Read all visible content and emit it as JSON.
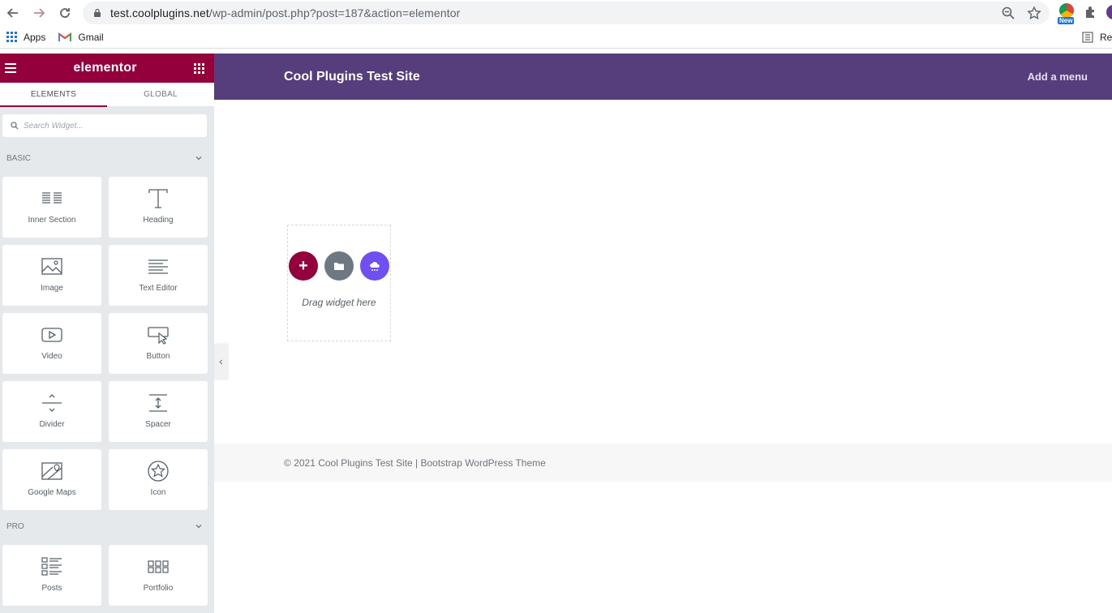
{
  "browser": {
    "url_host": "test.coolplugins.net",
    "url_path": "/wp-admin/post.php?post=187&action=elementor",
    "ext_badge": "New",
    "bookmarks": [
      {
        "label": "Apps"
      },
      {
        "label": "Gmail"
      }
    ],
    "reading_list_label": "Re"
  },
  "panel": {
    "brand": "elementor",
    "tabs": [
      {
        "label": "ELEMENTS"
      },
      {
        "label": "GLOBAL"
      }
    ],
    "search_placeholder": "Search Widget...",
    "categories": [
      {
        "label": "BASIC"
      },
      {
        "label": "PRO"
      }
    ],
    "basic_widgets": [
      {
        "label": "Inner Section",
        "icon": "inner-section-icon"
      },
      {
        "label": "Heading",
        "icon": "heading-icon"
      },
      {
        "label": "Image",
        "icon": "image-icon"
      },
      {
        "label": "Text Editor",
        "icon": "text-editor-icon"
      },
      {
        "label": "Video",
        "icon": "video-icon"
      },
      {
        "label": "Button",
        "icon": "button-icon"
      },
      {
        "label": "Divider",
        "icon": "divider-icon"
      },
      {
        "label": "Spacer",
        "icon": "spacer-icon"
      },
      {
        "label": "Google Maps",
        "icon": "google-maps-icon"
      },
      {
        "label": "Icon",
        "icon": "star-icon"
      }
    ],
    "pro_widgets": [
      {
        "label": "Posts",
        "icon": "posts-icon"
      },
      {
        "label": "Portfolio",
        "icon": "portfolio-icon"
      }
    ]
  },
  "preview": {
    "site_title": "Cool Plugins Test Site",
    "menu_label": "Add a menu",
    "drop_text": "Drag widget here",
    "add_symbol": "+",
    "footer_text": "© 2021 Cool Plugins Test Site | Bootstrap WordPress Theme"
  },
  "colors": {
    "elementor_brand": "#93003c",
    "site_header": "#563d7c",
    "cloud_button": "#6f4ef2"
  }
}
